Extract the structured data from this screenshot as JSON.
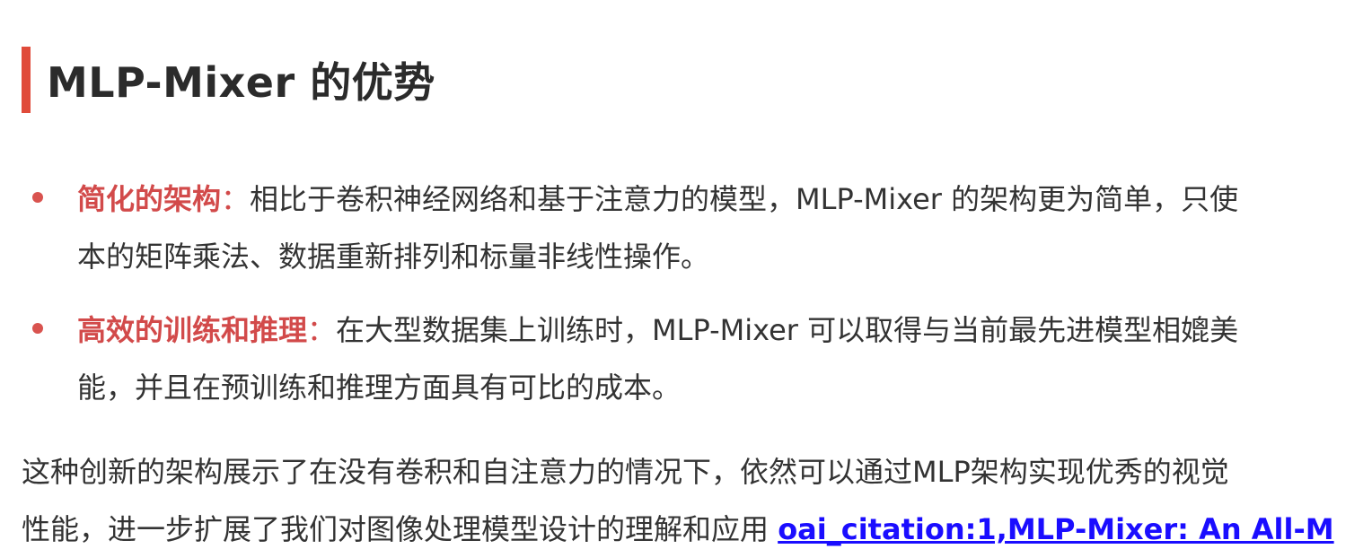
{
  "section": {
    "title": "MLP-Mixer 的优势"
  },
  "bullets": [
    {
      "key": "简化的架构",
      "colon": "：",
      "line1": "相比于卷积神经网络和基于注意力的模型，MLP-Mixer 的架构更为简单，只使",
      "line2": "本的矩阵乘法、数据重新排列和标量非线性操作。"
    },
    {
      "key": "高效的训练和推理",
      "colon": "：",
      "line1": "在大型数据集上训练时，MLP-Mixer 可以取得与当前最先进模型相媲美",
      "line2": "能，并且在预训练和推理方面具有可比的成本。"
    }
  ],
  "paragraph": {
    "line1": "这种创新的架构展示了在没有卷积和自注意力的情况下，依然可以通过MLP架构实现优秀的视觉",
    "line2": "性能，进一步扩展了我们对图像处理模型设计的理解和应用 ",
    "citation": "oai_citation:1,MLP-Mixer: An All-M"
  },
  "colors": {
    "accent_bar": "#e04b3a",
    "bullet_key": "#d24a4a",
    "link": "#1a0dff",
    "text": "#333333"
  }
}
